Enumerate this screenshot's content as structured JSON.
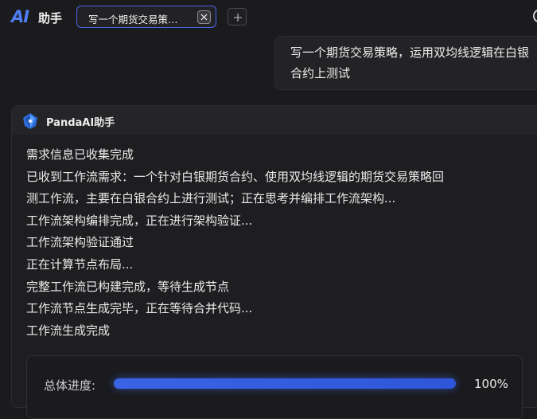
{
  "app": {
    "logo_text": "AI",
    "title": "助手"
  },
  "tabs": [
    {
      "label": "写一个期货交易策…",
      "active": true
    }
  ],
  "user_message": {
    "text": "写一个期货交易策略，运用双均线逻辑在白银合约上测试"
  },
  "assistant": {
    "name": "PandaAI助手",
    "log": [
      "需求信息已收集完成",
      "已收到工作流需求：一个针对白银期货合约、使用双均线逻辑的期货交易策略回",
      "测工作流，主要在白银合约上进行测试；正在思考并编排工作流架构...",
      "工作流架构编排完成，正在进行架构验证...",
      "工作流架构验证通过",
      "正在计算节点布局...",
      "完整工作流已构建完成，等待生成节点",
      "工作流节点生成完毕，正在等待合并代码...",
      "工作流生成完成"
    ],
    "progress": {
      "label": "总体进度:",
      "value": 100,
      "display": "100%"
    }
  },
  "colors": {
    "accent": "#4b63e8",
    "progress": "#3a63e6",
    "background": "#1b1b1d"
  },
  "icons": {
    "close": "close-icon",
    "add": "plus-icon",
    "avatar": "panda-logo-icon"
  }
}
